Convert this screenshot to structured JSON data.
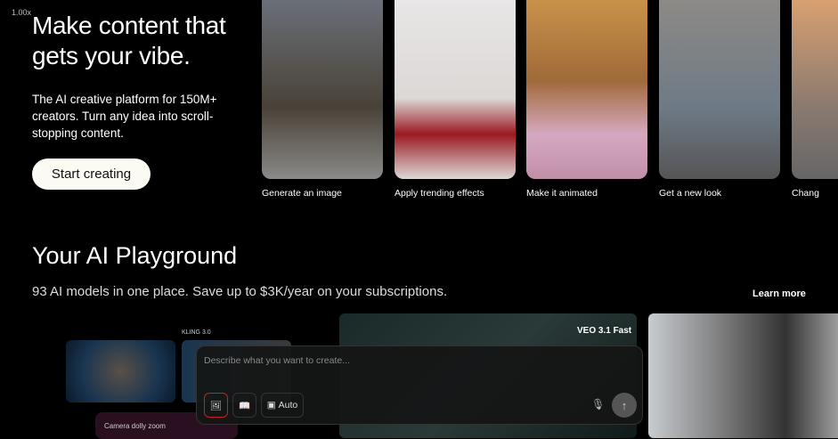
{
  "zoom": "1.00x",
  "hero": {
    "title_line1": "Make content that",
    "title_line2": "gets your vibe.",
    "subtitle": "The AI creative platform for 150M+ creators. Turn any idea into scroll-stopping content.",
    "cta": "Start creating"
  },
  "cards": [
    {
      "label": "Generate an image"
    },
    {
      "label": "Apply trending effects"
    },
    {
      "label": "Make it animated"
    },
    {
      "label": "Get a new look"
    },
    {
      "label": "Chang"
    }
  ],
  "playground": {
    "title": "Your AI Playground",
    "subtitle": "93 AI models in one place. Save up to $3K/year on your subscriptions.",
    "learn_more": "Learn more",
    "kling_label": "KLING 3.0",
    "veo_label": "VEO 3.1 Fast",
    "camera_label": "Camera dolly zoom"
  },
  "prompt": {
    "placeholder": "Describe what you want to create...",
    "auto_label": "Auto"
  }
}
